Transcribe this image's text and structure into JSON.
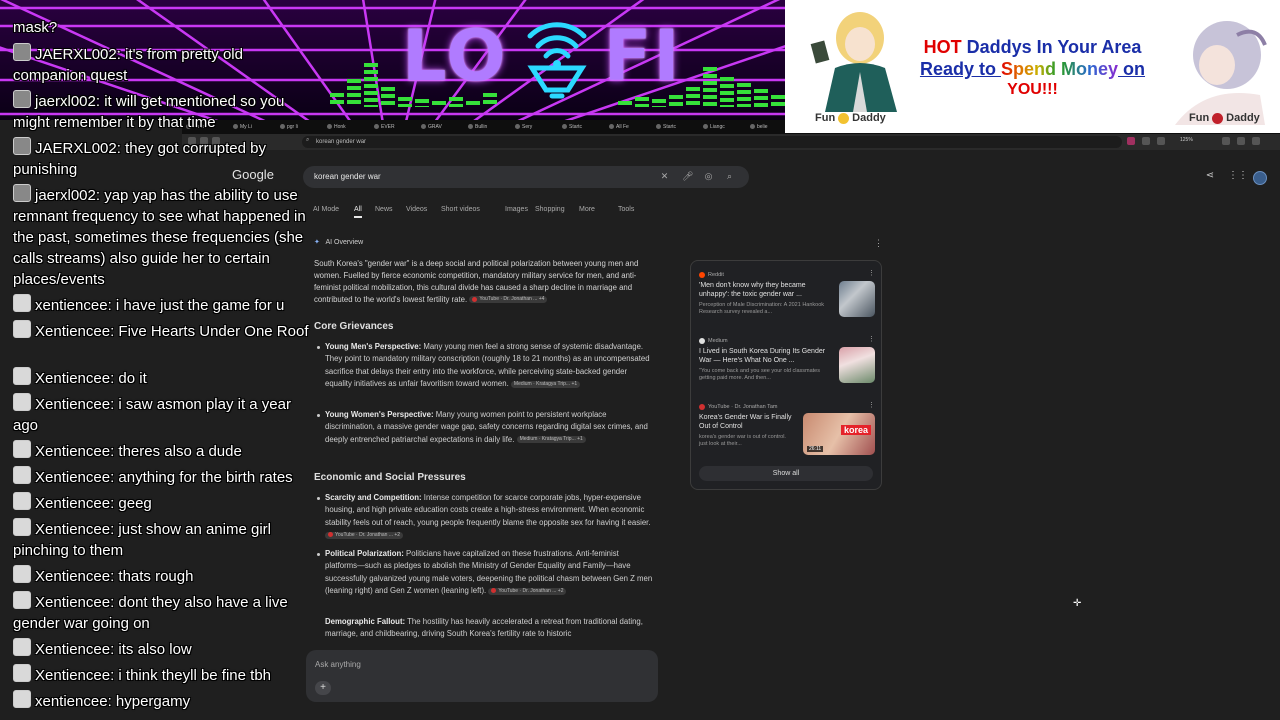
{
  "chat": {
    "messages": [
      {
        "text": "mask?"
      },
      {
        "user": "JAERXL002",
        "text": "it's from pretty old companion quest"
      },
      {
        "user": "jaerxl002",
        "text": "it will get mentioned so you might remember it by that time"
      },
      {
        "user": "JAERXL002",
        "text": "they got corrupted by punishing"
      },
      {
        "user": "jaerxl002",
        "text": "yap yap has the ability to use remnant frequency to see what happened in the past, sometimes these frequencies (she calls streams) also guide her to certain places/events"
      },
      {
        "user": "xentiencee",
        "text": "i have just the game for u"
      },
      {
        "user": "Xentiencee",
        "text": "Five Hearts Under One Roof"
      },
      {
        "user": "Xentiencee",
        "text": "do it"
      },
      {
        "user": "Xentiencee",
        "text": "i saw asmon play it a year ago"
      },
      {
        "user": "Xentiencee",
        "text": "theres also a dude"
      },
      {
        "user": "Xentiencee",
        "text": "anything for the birth rates"
      },
      {
        "user": "Xentiencee",
        "text": "geeg"
      },
      {
        "user": "Xentiencee",
        "text": "just show an anime girl pinching to them"
      },
      {
        "user": "Xentiencee",
        "text": "thats rough"
      },
      {
        "user": "Xentiencee",
        "text": "dont they also have a live gender war going on"
      },
      {
        "user": "Xentiencee",
        "text": "its also low"
      },
      {
        "user": "Xentiencee",
        "text": "i think theyll be fine tbh"
      },
      {
        "user": "xentiencee",
        "text": "hypergamy"
      }
    ]
  },
  "banner": {
    "logo_left": "LO",
    "logo_right": "FI"
  },
  "ad": {
    "line1_hot": "HOT",
    "line1_rest": " Daddys In Your Area",
    "line2_a": "Ready to ",
    "line2_spend": "Spend",
    "line2_b": " ",
    "line2_money": "Money",
    "line2_c": " on",
    "line3": "YOU!!!",
    "fun_left_a": "Fun",
    "fun_left_b": "Daddy",
    "fun_right_a": "Fun",
    "fun_right_b": "Daddy"
  },
  "browser": {
    "tabs": [
      "Punis",
      "My Li",
      "pgr li",
      "Honk",
      "EVER",
      "GRAV",
      "Bullin",
      "Sery",
      "Startc",
      "All Fe",
      "Startc",
      "Liangc",
      "belie",
      "anic",
      "AI's l"
    ],
    "url": "korean gender war",
    "zoom": "125%",
    "colors": {
      "bg": "#1f1f1f",
      "text": "#d4d4d4"
    }
  },
  "google": {
    "logo": "Google",
    "query": "korean gender war",
    "nav": [
      "AI Mode",
      "All",
      "News",
      "Videos",
      "Short videos",
      "Images",
      "Shopping",
      "More",
      "Tools"
    ],
    "active_nav": "All",
    "ai_header": "AI Overview",
    "intro": "South Korea's \"gender war\" is a deep social and political polarization between young men and women. Fuelled by fierce economic competition, mandatory military service for men, and anti-feminist political mobilization, this cultural divide has caused a sharp decline in marriage and contributed to the world's lowest fertility rate.",
    "intro_chip": "YouTube · Dr. Jonathan ... +4",
    "section1": "Core Grievances",
    "bullets1": [
      {
        "bold": "Young Men's Perspective:",
        "text": " Many young men feel a strong sense of systemic disadvantage. They point to mandatory military conscription (roughly 18 to 21 months) as an uncompensated sacrifice that delays their entry into the workforce, while perceiving state-backed gender equality initiatives as unfair favoritism toward women.",
        "chip": "Medium · Kratagya Trip... +1"
      },
      {
        "bold": "Young Women's Perspective:",
        "text": " Many young women point to persistent workplace discrimination, a massive gender wage gap, safety concerns regarding digital sex crimes, and deeply entrenched patriarchal expectations in daily life.",
        "chip": "Medium · Kratagya Trip... +1"
      }
    ],
    "section2": "Economic and Social Pressures",
    "bullets2": [
      {
        "bold": "Scarcity and Competition:",
        "text": " Intense competition for scarce corporate jobs, hyper-expensive housing, and high private education costs create a high-stress environment. When economic stability feels out of reach, young people frequently blame the opposite sex for having it easier.",
        "chip": "YouTube · Dr. Jonathan ... +2"
      },
      {
        "bold": "Political Polarization:",
        "text": " Politicians have capitalized on these frustrations. Anti-feminist platforms—such as pledges to abolish the Ministry of Gender Equality and Family—have successfully galvanized young male voters, deepening the political chasm between Gen Z men (leaning right) and Gen Z women (leaning left).",
        "chip": "YouTube · Dr. Jonathan ... +2"
      },
      {
        "bold": "Demographic Fallout:",
        "text": " The hostility has heavily accelerated a retreat from traditional dating, marriage, and childbearing, driving South Korea's fertility rate to historic",
        "chip": ""
      }
    ],
    "sources": [
      {
        "site": "Reddit",
        "title": "'Men don't know why they became unhappy': the toxic gender war ...",
        "snippet": "Perception of Male Discrimination: A 2021 Hankook Research survey revealed a..."
      },
      {
        "site": "Medium",
        "title": "I Lived in South Korea During Its Gender War — Here's What No One ...",
        "snippet": "\"You come back and you see your old classmates getting paid more. And then..."
      },
      {
        "site": "YouTube · Dr. Jonathan Tam",
        "title": "Korea's Gender War is Finally Out of Control",
        "snippet": "korea's gender war is out of control. just look at their...",
        "thumb_label": "korea",
        "duration": "26:11"
      }
    ],
    "show_all": "Show all",
    "ask_placeholder": "Ask anything"
  }
}
